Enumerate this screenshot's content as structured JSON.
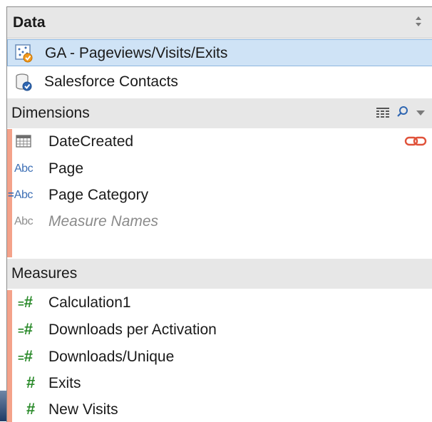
{
  "panel": {
    "title": "Data"
  },
  "datasources": [
    {
      "label": "GA - Pageviews/Visits/Exits",
      "icon": "ga-datasource-icon",
      "selected": true
    },
    {
      "label": "Salesforce Contacts",
      "icon": "database-check-icon",
      "selected": false
    }
  ],
  "dimensions": {
    "title": "Dimensions",
    "fields": [
      {
        "label": "DateCreated",
        "type": "date"
      },
      {
        "label": "Page",
        "type": "string"
      },
      {
        "label": "Page Category",
        "type": "string-calculated"
      },
      {
        "label": "Measure Names",
        "type": "string-generated"
      }
    ]
  },
  "measures": {
    "title": "Measures",
    "fields": [
      {
        "label": "Calculation1",
        "type": "number-calculated"
      },
      {
        "label": "Downloads per Activation",
        "type": "number-calculated"
      },
      {
        "label": "Downloads/Unique",
        "type": "number-calculated"
      },
      {
        "label": "Exits",
        "type": "number"
      },
      {
        "label": "New Visits",
        "type": "number"
      }
    ]
  },
  "icons": {
    "abc": "Abc",
    "hash": "#",
    "eq": "="
  },
  "colors": {
    "accent_bar": "#f4a28a",
    "selection": "#cfe3f6",
    "link": "#e0523a",
    "measure_green": "#2a8a2a",
    "dimension_blue": "#3d6fb5"
  }
}
